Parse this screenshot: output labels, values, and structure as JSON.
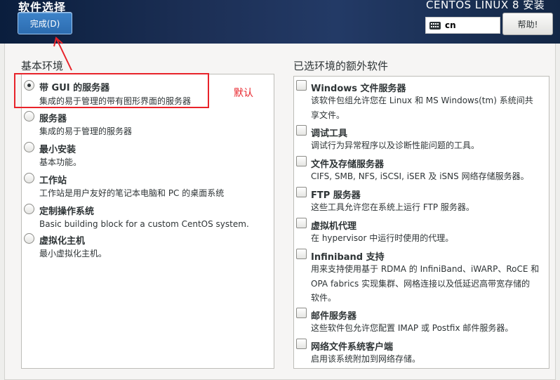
{
  "header": {
    "page_title": "软件选择",
    "done_button": "完成(D)",
    "product_title": "CENTOS LINUX 8 安装",
    "keyboard_layout": "cn",
    "help_button": "帮助!"
  },
  "base_environment": {
    "heading": "基本环境",
    "items": [
      {
        "title": "带 GUI 的服务器",
        "desc": "集成的易于管理的带有图形界面的服务器",
        "selected": true
      },
      {
        "title": "服务器",
        "desc": "集成的易于管理的服务器",
        "selected": false
      },
      {
        "title": "最小安装",
        "desc": "基本功能。",
        "selected": false
      },
      {
        "title": "工作站",
        "desc": "工作站是用户友好的笔记本电脑和 PC 的桌面系统",
        "selected": false
      },
      {
        "title": "定制操作系统",
        "desc": "Basic building block for a custom CentOS system.",
        "selected": false
      },
      {
        "title": "虚拟化主机",
        "desc": "最小虚拟化主机。",
        "selected": false
      }
    ]
  },
  "addons": {
    "heading": "已选环境的额外软件",
    "items": [
      {
        "title": "Windows 文件服务器",
        "desc_lines": [
          "该软件包组允许您在 Linux 和 MS Windows(tm) 系统间共",
          "享文件。"
        ],
        "checked": false
      },
      {
        "title": "调试工具",
        "desc_lines": [
          "调试行为异常程序以及诊断性能问题的工具。"
        ],
        "checked": false
      },
      {
        "title": "文件及存储服务器",
        "desc_lines": [
          "CIFS, SMB, NFS, iSCSI, iSER 及 iSNS 网络存储服务器。"
        ],
        "checked": false
      },
      {
        "title": "FTP 服务器",
        "desc_lines": [
          "这些工具允许您在系统上运行 FTP 服务器。"
        ],
        "checked": false
      },
      {
        "title": "虚拟机代理",
        "desc_lines": [
          "在 hypervisor 中运行时使用的代理。"
        ],
        "checked": false
      },
      {
        "title": "Infiniband 支持",
        "desc_lines": [
          "用来支持使用基于 RDMA 的 InfiniBand、iWARP、RoCE 和",
          "OPA fabrics 实现集群、网格连接以及低延迟高带宽存储的",
          "软件。"
        ],
        "checked": false
      },
      {
        "title": "邮件服务器",
        "desc_lines": [
          "这些软件包允许您配置 IMAP 或 Postfix 邮件服务器。"
        ],
        "checked": false
      },
      {
        "title": "网络文件系统客户端",
        "desc_lines": [
          "启用该系统附加到网络存储。"
        ],
        "checked": false
      }
    ]
  },
  "annotation": {
    "label": "默认",
    "color": "#e8232a"
  }
}
